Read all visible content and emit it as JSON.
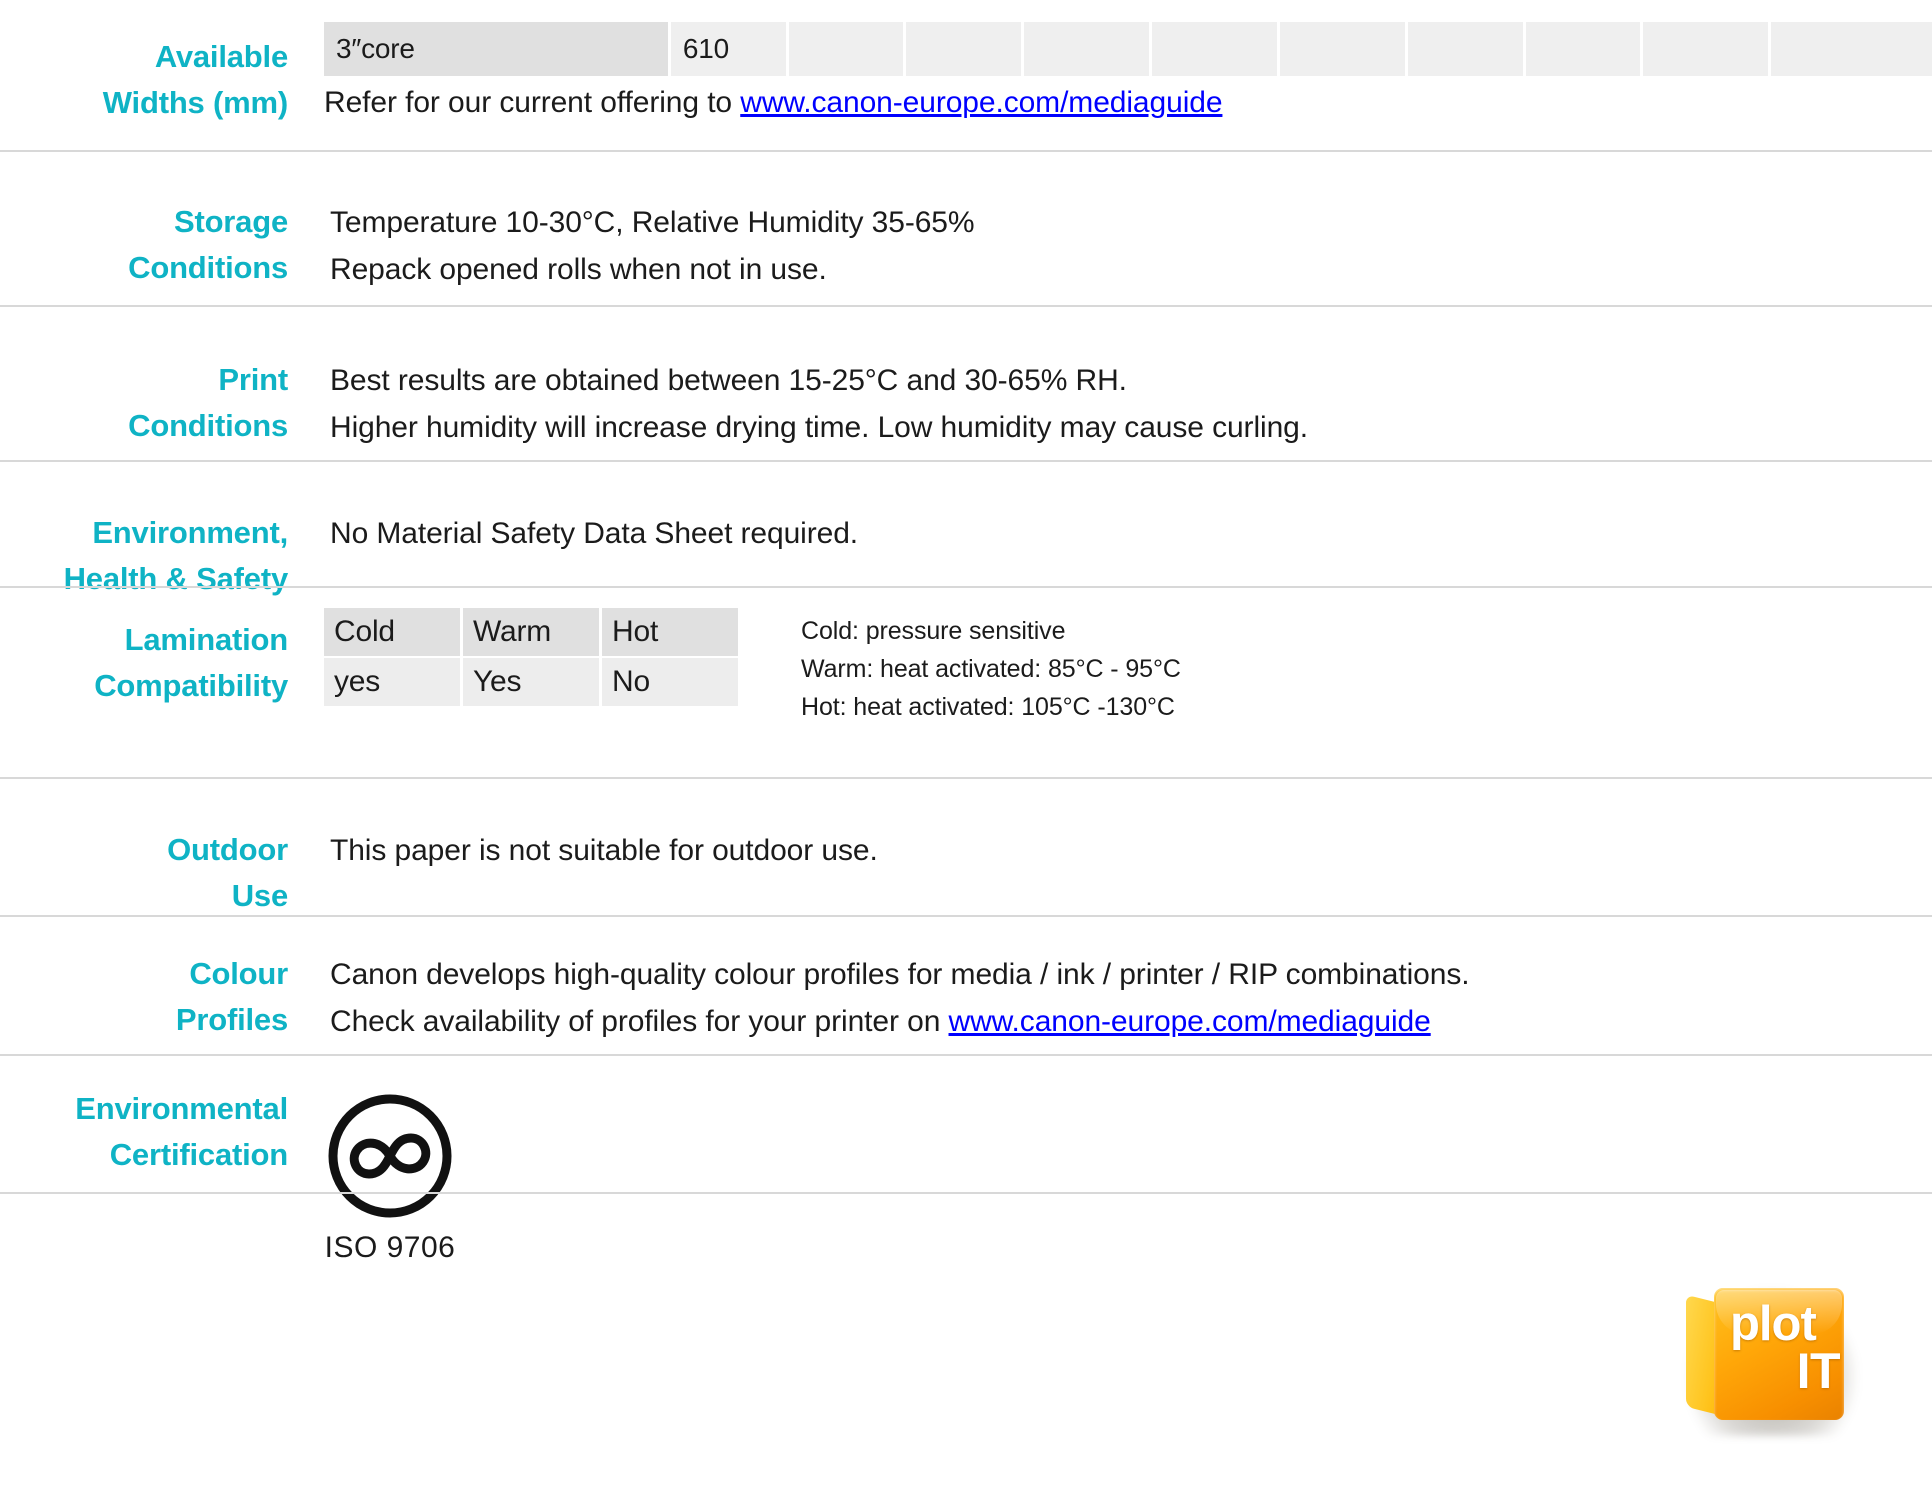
{
  "colors": {
    "label_teal": "#0fb3c5",
    "link_blue": "#0000ff",
    "divider_gray": "#d8d8d8",
    "table_cell_gray": "#efefef",
    "table_first_cell_gray": "#e0e0e0",
    "logo_orange": "#ffa608"
  },
  "sections": {
    "available_widths": {
      "label_line1": "Available",
      "label_line2": "Widths (mm)",
      "table": {
        "cells": [
          "3″core",
          "610",
          "",
          "",
          "",
          "",
          "",
          "",
          "",
          "",
          ""
        ]
      },
      "note_prefix": "Refer for our current offering to ",
      "note_link": "www.canon-europe.com/mediaguide"
    },
    "storage_conditions": {
      "label_line1": "Storage",
      "label_line2": "Conditions",
      "lines": [
        "Temperature 10-30°C, Relative Humidity 35-65%",
        "Repack opened rolls when not in use."
      ]
    },
    "print_conditions": {
      "label_line1": "Print",
      "label_line2": "Conditions",
      "lines": [
        "Best results are obtained between 15-25°C and 30-65% RH.",
        "Higher humidity will increase drying time. Low humidity may cause curling."
      ]
    },
    "environment_health_safety": {
      "label_line1": "Environment,",
      "label_line2": "Health & Safety",
      "lines": [
        "No Material Safety Data Sheet required."
      ]
    },
    "lamination_compatibility": {
      "label_line1": "Lamination",
      "label_line2": "Compatibility",
      "table": {
        "headers": [
          "Cold",
          "Warm",
          "Hot"
        ],
        "values": [
          "yes",
          "Yes",
          "No"
        ]
      },
      "notes": [
        "Cold: pressure sensitive",
        "Warm: heat activated: 85°C - 95°C",
        "Hot: heat activated: 105°C -130°C"
      ]
    },
    "outdoor_use": {
      "label_line1": "Outdoor",
      "label_line2": "Use",
      "lines": [
        "This paper is not suitable for outdoor use."
      ]
    },
    "colour_profiles": {
      "label_line1": "Colour",
      "label_line2": "Profiles",
      "line1": "Canon develops high-quality colour profiles for media / ink / printer / RIP combinations.",
      "line2_prefix": "Check availability of profiles for your printer on ",
      "line2_link": "www.canon-europe.com/mediaguide"
    },
    "environmental_certification": {
      "label_line1": "Environmental",
      "label_line2": "Certification",
      "iso_caption": "ISO 9706",
      "iso_symbol_name": "permanent-paper-infinity-in-circle"
    }
  },
  "logo": {
    "line1": "plot",
    "line2": "IT"
  }
}
